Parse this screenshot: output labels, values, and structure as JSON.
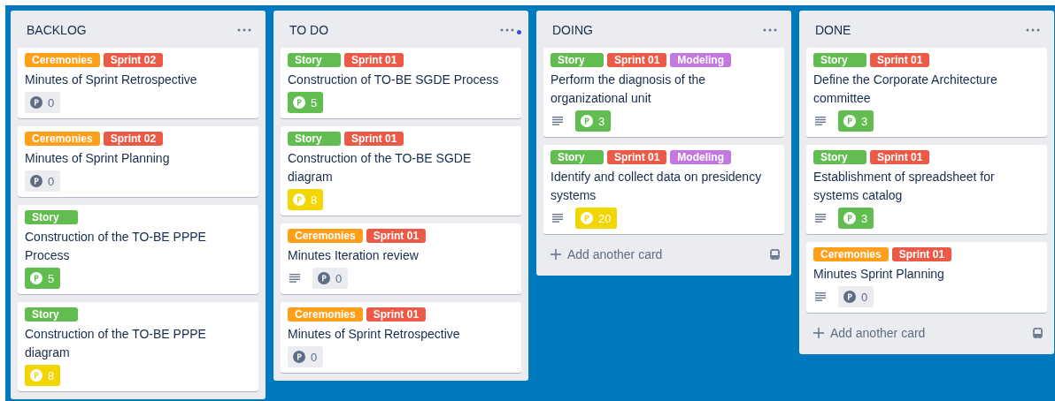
{
  "lists": [
    {
      "title": "BACKLOG",
      "notification": false,
      "cards": [
        {
          "labels": [
            {
              "text": "Ceremonies",
              "color": "#ff9f1a"
            },
            {
              "text": "Sprint 02",
              "color": "#eb5a46"
            }
          ],
          "title": "Minutes of Sprint Retrospective",
          "has_description": false,
          "points": {
            "value": "0",
            "color": "#ebecf0"
          }
        },
        {
          "labels": [
            {
              "text": "Ceremonies",
              "color": "#ff9f1a"
            },
            {
              "text": "Sprint 02",
              "color": "#eb5a46"
            }
          ],
          "title": "Minutes of Sprint Planning",
          "has_description": false,
          "points": {
            "value": "0",
            "color": "#ebecf0"
          }
        },
        {
          "labels": [
            {
              "text": "Story",
              "color": "#61bd4f"
            }
          ],
          "title": "Construction of the TO-BE PPPE Process",
          "has_description": false,
          "points": {
            "value": "5",
            "color": "#61bd4f"
          }
        },
        {
          "labels": [
            {
              "text": "Story",
              "color": "#61bd4f"
            }
          ],
          "title": "Construction of the TO-BE PPPE diagram",
          "has_description": false,
          "points": {
            "value": "8",
            "color": "#f2d600"
          }
        }
      ]
    },
    {
      "title": "TO DO",
      "notification": true,
      "cards": [
        {
          "labels": [
            {
              "text": "Story",
              "color": "#61bd4f"
            },
            {
              "text": "Sprint 01",
              "color": "#eb5a46"
            }
          ],
          "title": "Construction of TO-BE SGDE Process",
          "has_description": false,
          "points": {
            "value": "5",
            "color": "#61bd4f"
          }
        },
        {
          "labels": [
            {
              "text": "Story",
              "color": "#61bd4f"
            },
            {
              "text": "Sprint 01",
              "color": "#eb5a46"
            }
          ],
          "title": "Construction of the TO-BE SGDE diagram",
          "has_description": false,
          "points": {
            "value": "8",
            "color": "#f2d600"
          }
        },
        {
          "labels": [
            {
              "text": "Ceremonies",
              "color": "#ff9f1a"
            },
            {
              "text": "Sprint 01",
              "color": "#eb5a46"
            }
          ],
          "title": "Minutes Iteration review",
          "has_description": true,
          "points": {
            "value": "0",
            "color": "#ebecf0"
          }
        },
        {
          "labels": [
            {
              "text": "Ceremonies",
              "color": "#ff9f1a"
            },
            {
              "text": "Sprint 01",
              "color": "#eb5a46"
            }
          ],
          "title": "Minutes of Sprint Retrospective",
          "has_description": false,
          "points": {
            "value": "0",
            "color": "#ebecf0"
          }
        }
      ]
    },
    {
      "title": "DOING",
      "notification": false,
      "cards": [
        {
          "labels": [
            {
              "text": "Story",
              "color": "#61bd4f"
            },
            {
              "text": "Sprint 01",
              "color": "#eb5a46"
            },
            {
              "text": "Modeling",
              "color": "#c377e0"
            }
          ],
          "title": "Perform the diagnosis of the organizational unit",
          "has_description": true,
          "points": {
            "value": "3",
            "color": "#61bd4f"
          }
        },
        {
          "labels": [
            {
              "text": "Story",
              "color": "#61bd4f"
            },
            {
              "text": "Sprint 01",
              "color": "#eb5a46"
            },
            {
              "text": "Modeling",
              "color": "#c377e0"
            }
          ],
          "title": "Identify and collect data on presidency systems",
          "has_description": true,
          "points": {
            "value": "20",
            "color": "#f2d600"
          }
        }
      ],
      "add_card": "Add another card"
    },
    {
      "title": "DONE",
      "notification": false,
      "cards": [
        {
          "labels": [
            {
              "text": "Story",
              "color": "#61bd4f"
            },
            {
              "text": "Sprint 01",
              "color": "#eb5a46"
            }
          ],
          "title": "Define the Corporate Architecture committee",
          "has_description": true,
          "points": {
            "value": "3",
            "color": "#61bd4f"
          }
        },
        {
          "labels": [
            {
              "text": "Story",
              "color": "#61bd4f"
            },
            {
              "text": "Sprint 01",
              "color": "#eb5a46"
            }
          ],
          "title": "Establishment of spreadsheet for systems catalog",
          "has_description": true,
          "points": {
            "value": "3",
            "color": "#61bd4f"
          }
        },
        {
          "labels": [
            {
              "text": "Ceremonies",
              "color": "#ff9f1a"
            },
            {
              "text": "Sprint 01",
              "color": "#eb5a46"
            }
          ],
          "title": "Minutes Sprint Planning",
          "has_description": true,
          "points": {
            "value": "0",
            "color": "#ebecf0"
          }
        }
      ],
      "add_card": "Add another card"
    }
  ]
}
